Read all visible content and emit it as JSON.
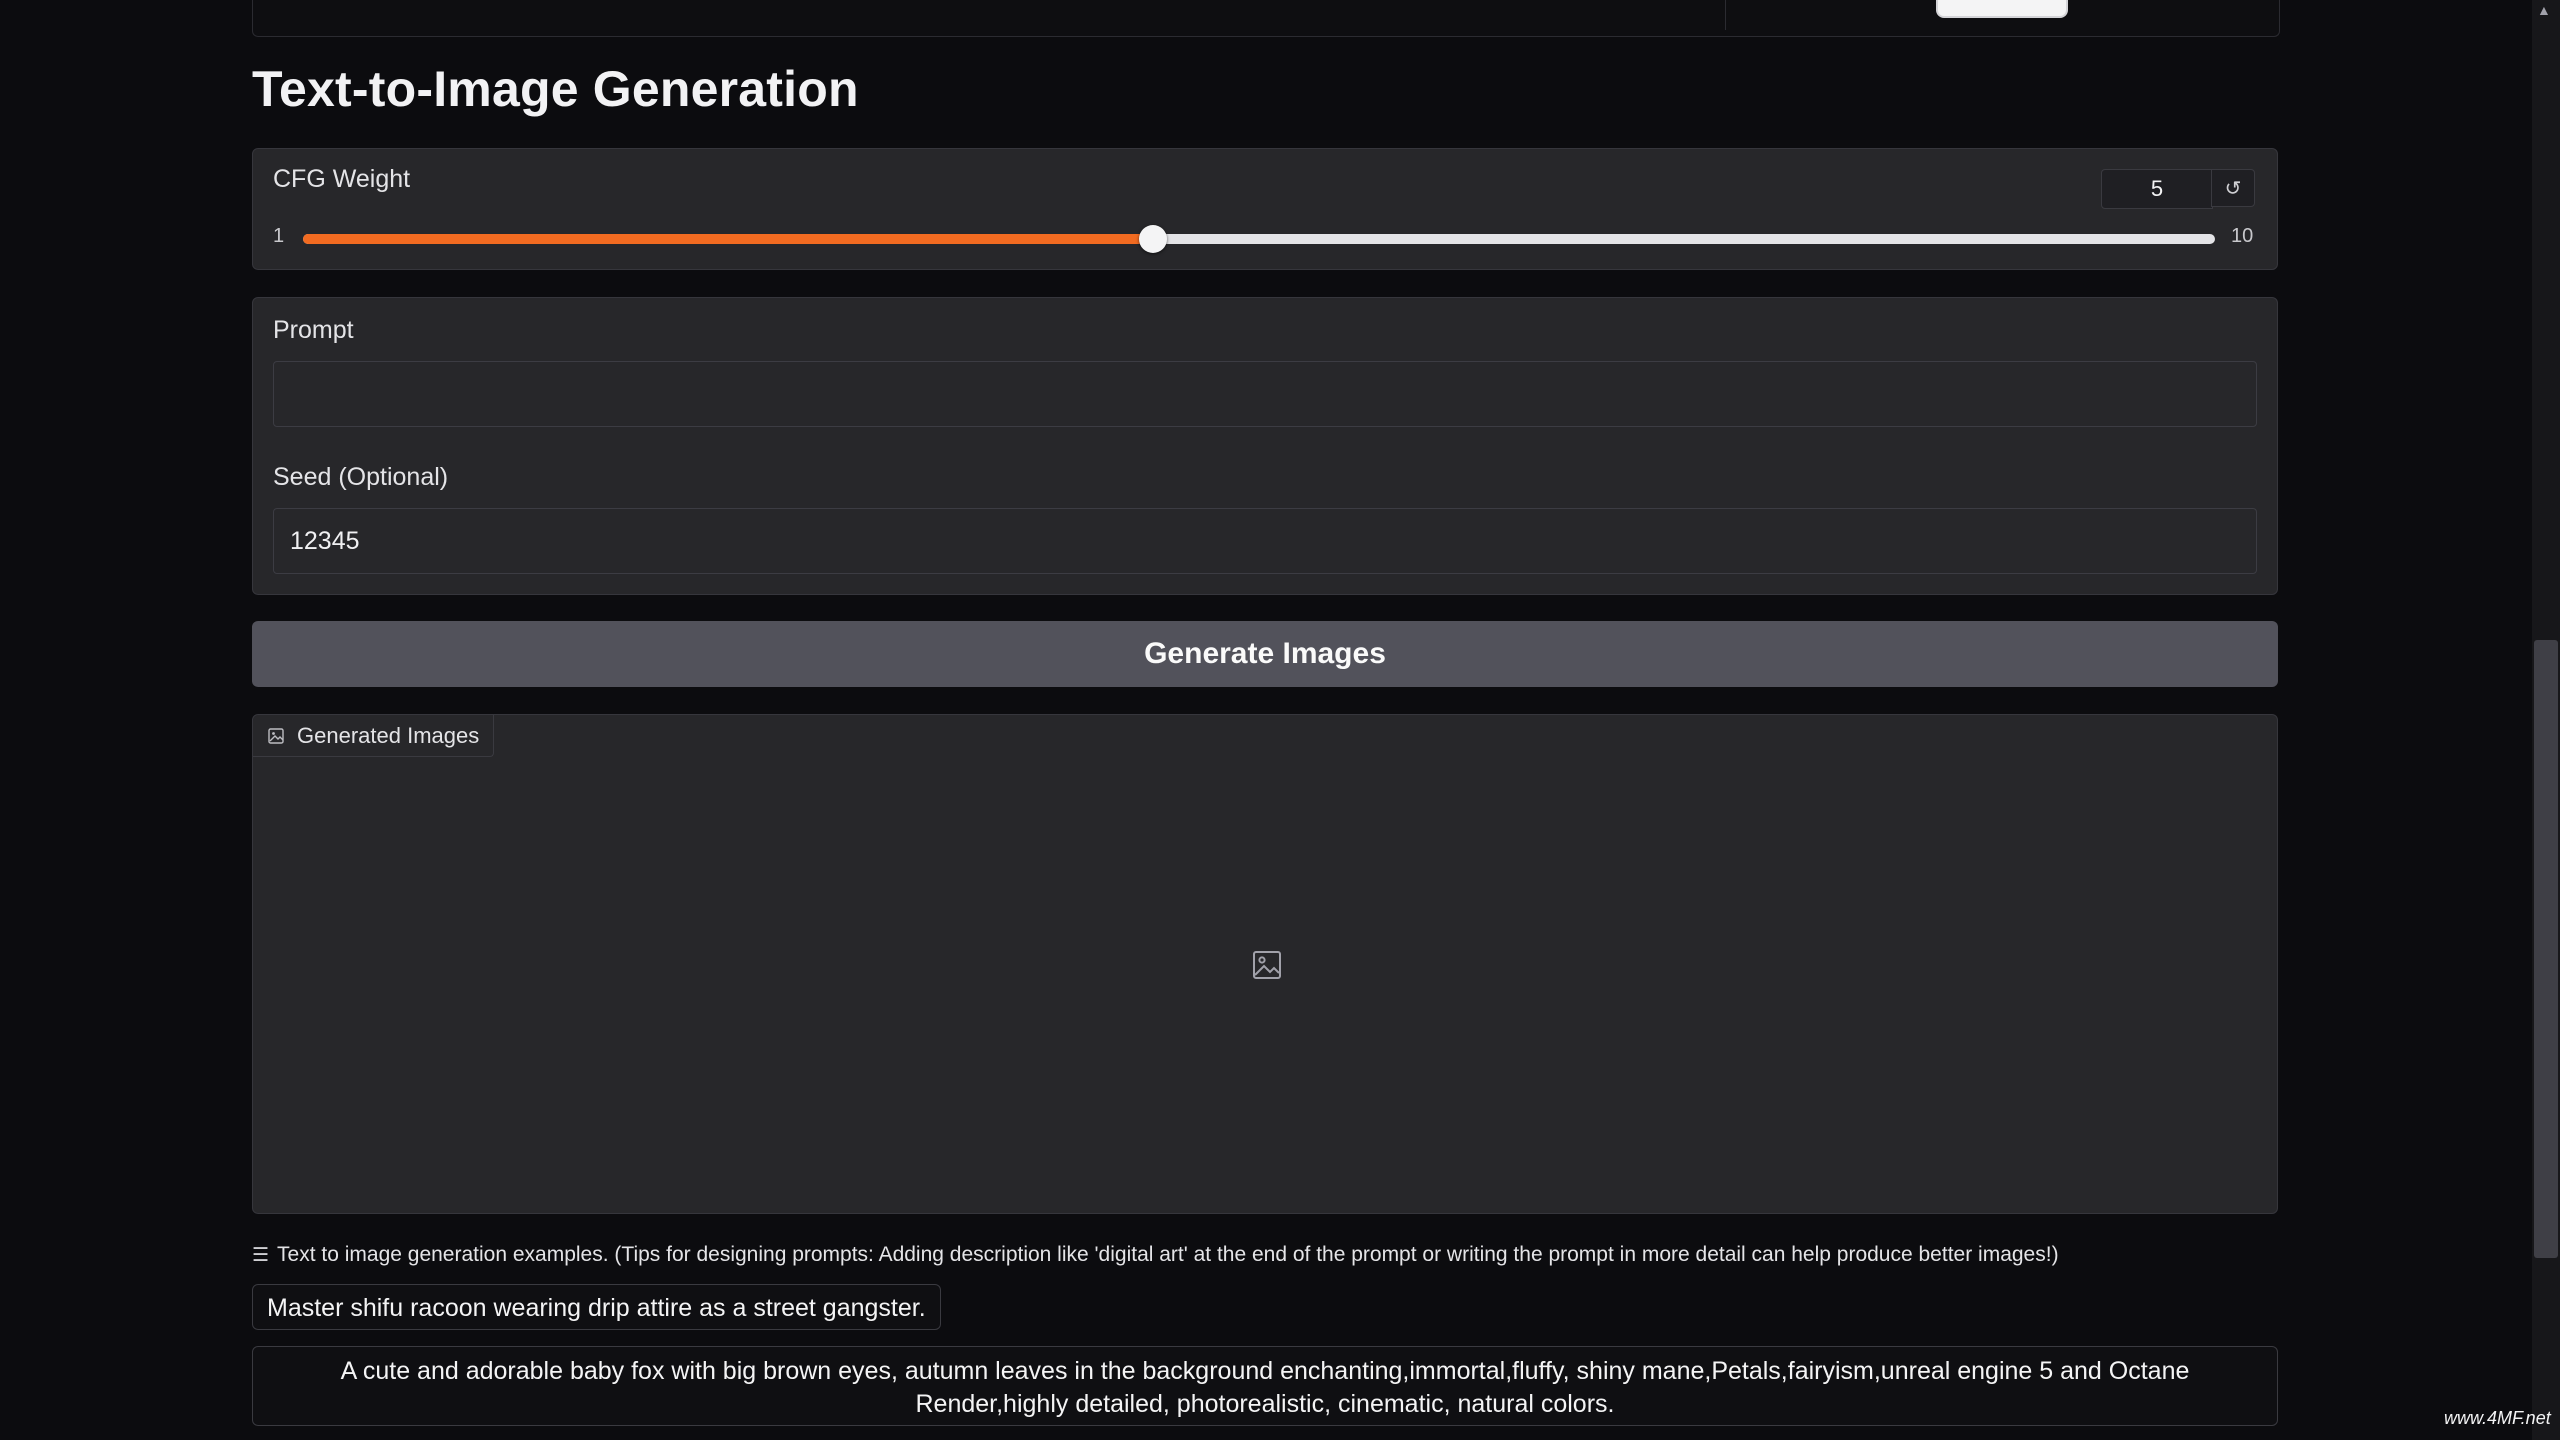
{
  "page_title": "Text-to-Image Generation",
  "cfg": {
    "label": "CFG Weight",
    "value": "5",
    "min": "1",
    "max": "10",
    "fraction": 0.4444,
    "reset_glyph": "↺"
  },
  "prompt": {
    "label": "Prompt",
    "value": "",
    "placeholder": ""
  },
  "seed": {
    "label": "Seed (Optional)",
    "value": "12345"
  },
  "generate_button": "Generate Images",
  "gallery": {
    "tab_label": "Generated Images",
    "icon": "image-icon"
  },
  "examples": {
    "header": "Text to image generation examples. (Tips for designing prompts: Adding description like 'digital art' at the end of the prompt or writing the prompt in more detail can help produce better images!)",
    "items": [
      "Master shifu racoon wearing drip attire as a street gangster.",
      "A cute and adorable baby fox with big brown eyes, autumn leaves in the background enchanting,immortal,fluffy, shiny mane,Petals,fairyism,unreal engine 5 and Octane Render,highly detailed, photorealistic, cinematic, natural colors."
    ]
  },
  "watermark": "www.4MF.net",
  "colors": {
    "accent": "#f26b21",
    "panel": "#27272a",
    "background": "#0c0c0f",
    "button": "#52525b"
  }
}
